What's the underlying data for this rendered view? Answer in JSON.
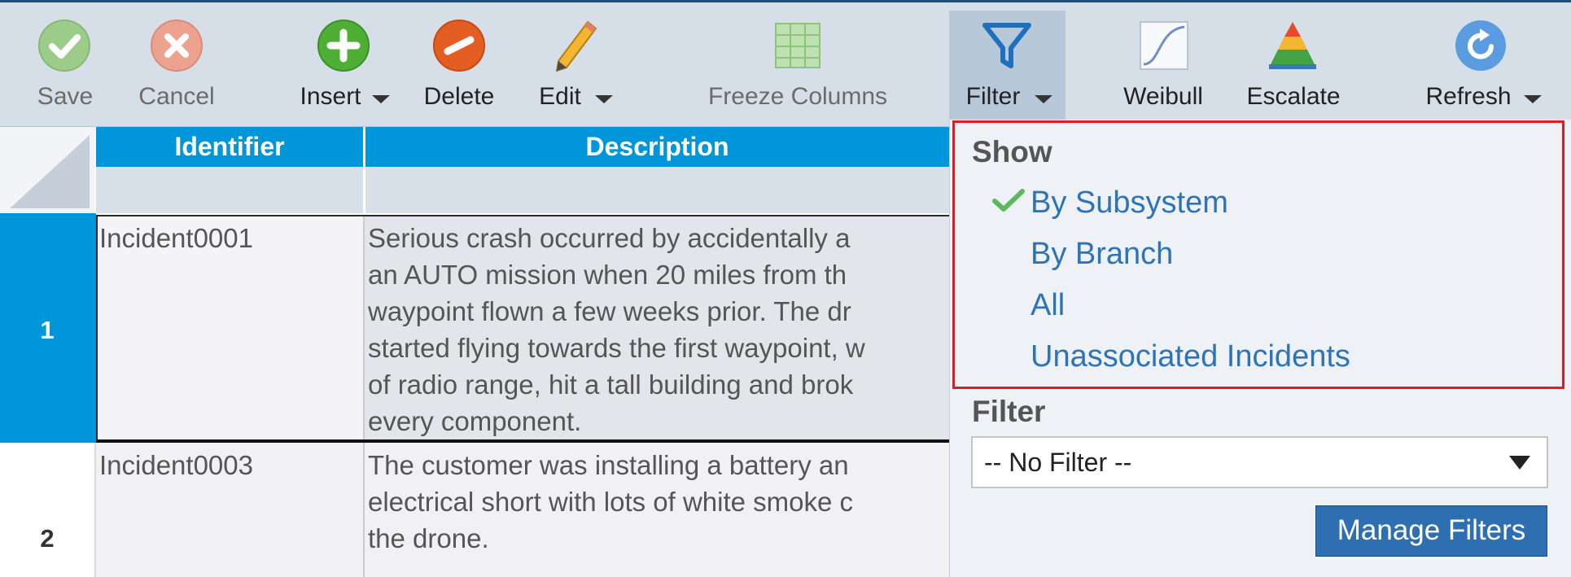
{
  "toolbar": {
    "save_label": "Save",
    "cancel_label": "Cancel",
    "insert_label": "Insert",
    "delete_label": "Delete",
    "edit_label": "Edit",
    "freeze_label": "Freeze Columns",
    "filter_label": "Filter",
    "weibull_label": "Weibull",
    "escalate_label": "Escalate",
    "refresh_label": "Refresh",
    "icons": {
      "save": "check-circle-icon",
      "cancel": "x-circle-icon",
      "insert": "plus-circle-icon",
      "delete": "minus-circle-icon",
      "edit": "pencil-icon",
      "freeze": "grid-icon",
      "filter": "funnel-icon",
      "weibull": "curve-chart-icon",
      "escalate": "pyramid-icon",
      "refresh": "refresh-icon"
    }
  },
  "grid": {
    "columns": [
      "Identifier",
      "Description"
    ],
    "rows": [
      {
        "number": "1",
        "identifier": "Incident0001",
        "description": [
          "Serious crash occurred by accidentally a",
          "an AUTO mission when 20 miles from th",
          "waypoint flown a few weeks prior. The dr",
          "started flying towards the first waypoint, w",
          "of radio range, hit a tall building and brok",
          "every component."
        ]
      },
      {
        "number": "2",
        "identifier": "Incident0003",
        "description": [
          "The customer was installing a battery an",
          "electrical short with lots of white smoke c",
          "the drone."
        ]
      }
    ]
  },
  "filter_menu": {
    "show_title": "Show",
    "options": [
      "By Subsystem",
      "By Branch",
      "All",
      "Unassociated Incidents"
    ],
    "selected_option": "By Subsystem",
    "filter_title": "Filter",
    "filter_value": "-- No Filter --",
    "manage_button": "Manage Filters"
  },
  "colors": {
    "toolbar_bg": "#d6dfe8",
    "header_blue": "#0096d9",
    "link_blue": "#2e73b6",
    "highlight_red": "#e11b22",
    "button_blue": "#2e6fb2"
  }
}
